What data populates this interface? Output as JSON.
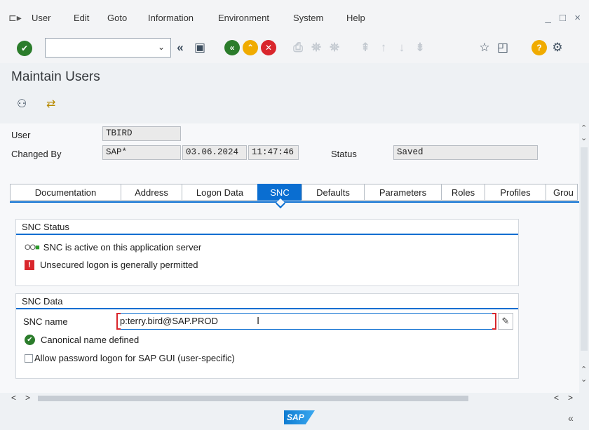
{
  "menu": {
    "items": [
      "User",
      "Edit",
      "Goto",
      "Information",
      "Environment",
      "System",
      "Help"
    ],
    "window_controls": "_ □ ×"
  },
  "toolbar": {
    "command_value": ""
  },
  "page": {
    "title": "Maintain Users"
  },
  "header": {
    "user_label": "User",
    "user_value": "TBIRD",
    "changed_by_label": "Changed By",
    "changed_by_value": "SAP*",
    "changed_date": "03.06.2024",
    "changed_time": "11:47:46",
    "status_label": "Status",
    "status_value": "Saved"
  },
  "tabs": [
    "Documentation",
    "Address",
    "Logon Data",
    "SNC",
    "Defaults",
    "Parameters",
    "Roles",
    "Profiles",
    "Grou"
  ],
  "active_tab": "SNC",
  "snc_status": {
    "title": "SNC Status",
    "active_text": "SNC is active on this application server",
    "warning_text": "Unsecured logon is generally permitted"
  },
  "snc_data": {
    "title": "SNC Data",
    "name_label": "SNC name",
    "name_value": "p:terry.bird@SAP.PROD",
    "canonical_text": "Canonical name defined",
    "checkbox_label": "Allow password logon for SAP GUI (user-specific)"
  },
  "footer": {
    "logo_text": "SAP",
    "collapse": "«"
  },
  "colors": {
    "accent": "#0a6ed1",
    "ok": "#2b7c2b",
    "error": "#d9262c",
    "warning": "#f0ab00"
  }
}
